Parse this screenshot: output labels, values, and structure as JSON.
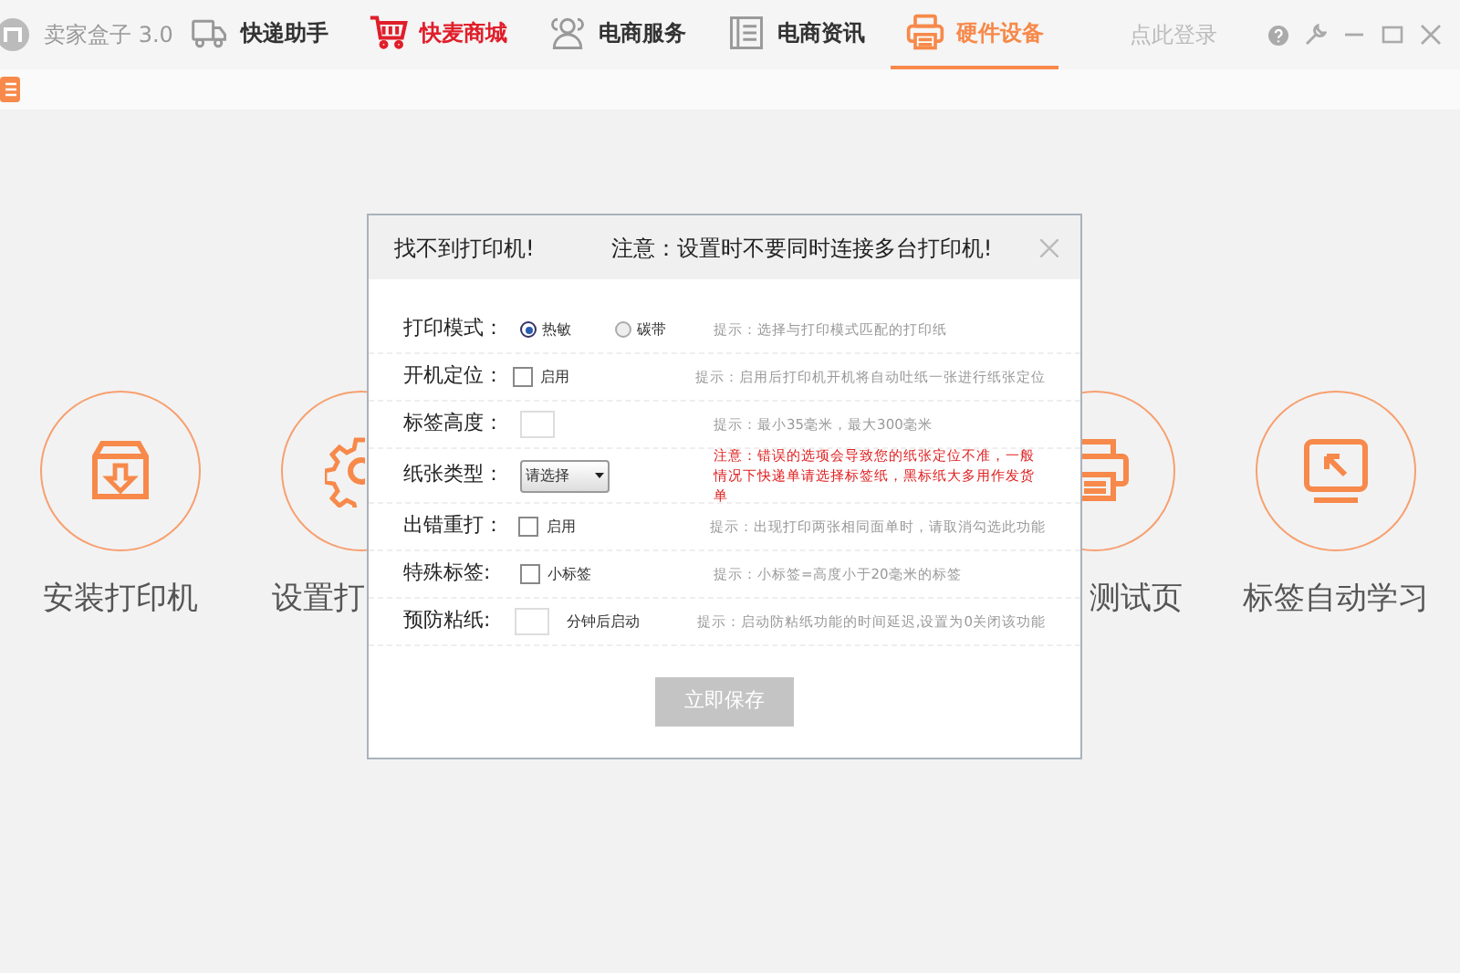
{
  "app": {
    "name": "卖家盒子 3.0"
  },
  "tabs": [
    {
      "label": "快递助手",
      "selected": false,
      "highlight": false
    },
    {
      "label": "快麦商城",
      "selected": false,
      "highlight": true
    },
    {
      "label": "电商服务",
      "selected": false,
      "highlight": false
    },
    {
      "label": "电商资讯",
      "selected": false,
      "highlight": false
    },
    {
      "label": "硬件设备",
      "selected": true,
      "highlight": false
    }
  ],
  "login": "点此登录",
  "tiles": [
    {
      "label": "安装打印机"
    },
    {
      "label": "设置打"
    },
    {
      "label": "测试页"
    },
    {
      "label": "标签自动学习"
    }
  ],
  "dialog": {
    "title": "找不到打印机!",
    "notice": "注意：设置时不要同时连接多台打印机!",
    "rows": [
      {
        "kind": "radio",
        "label": "打印模式：",
        "options": [
          {
            "label": "热敏",
            "selected": true
          },
          {
            "label": "碳带",
            "selected": false
          }
        ],
        "hint": "提示：选择与打印模式匹配的打印纸",
        "warning": false
      },
      {
        "kind": "checkbox",
        "label": "开机定位：",
        "option": "启用",
        "checked": false,
        "hint": "提示：启用后打印机开机将自动吐纸一张进行纸张定位",
        "warning": false
      },
      {
        "kind": "input",
        "label": "标签高度：",
        "hint": "提示：最小35毫米，最大300毫米",
        "warning": false
      },
      {
        "kind": "select",
        "label": "纸张类型：",
        "value": "请选择",
        "hint": "注意：错误的选项会导致您的纸张定位不准，一般情况下快递单请选择标签纸，黑标纸大多用作发货单",
        "warning": true
      },
      {
        "kind": "checkbox",
        "label": "出错重打：",
        "option": "启用",
        "checked": false,
        "hint": "提示：出现打印两张相同面单时，请取消勾选此功能",
        "warning": false
      },
      {
        "kind": "checkbox",
        "label": "特殊标签:",
        "option": "小标签",
        "checked": false,
        "hint": "提示：小标签=高度小于20毫米的标签",
        "warning": false
      },
      {
        "kind": "input",
        "label": "预防粘纸:",
        "suffix": "分钟后启动",
        "hint": "提示：启动防粘纸功能的时间延迟,设置为0关闭该功能",
        "warning": false
      }
    ],
    "save": "立即保存"
  }
}
